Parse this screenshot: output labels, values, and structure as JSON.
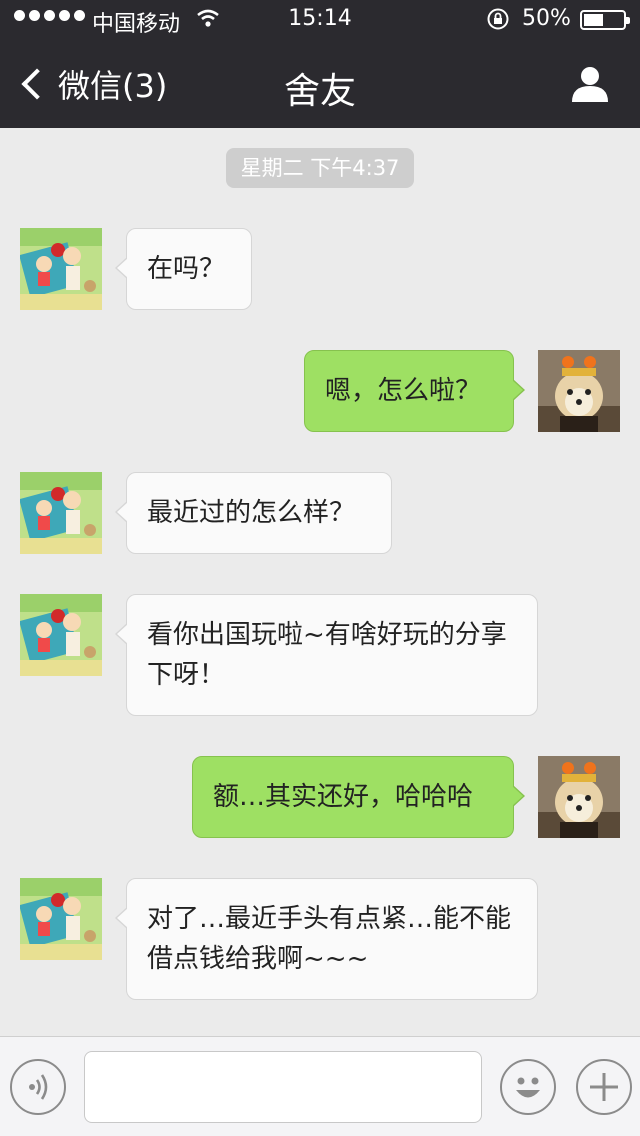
{
  "status_bar": {
    "carrier": "中国移动",
    "time": "15:14",
    "battery": "50%",
    "battery_level": 0.5
  },
  "nav": {
    "back_label": "微信(3)",
    "title": "舍友"
  },
  "chat": {
    "timestamp": "星期二 下午4:37",
    "messages": [
      {
        "direction": "incoming",
        "text": "在吗？"
      },
      {
        "direction": "outgoing",
        "text": "嗯，怎么啦？"
      },
      {
        "direction": "incoming",
        "text": "最近过的怎么样？"
      },
      {
        "direction": "incoming",
        "text": "看你出国玩啦~有啥好玩的分享下呀！"
      },
      {
        "direction": "outgoing",
        "text": "额…其实还好，哈哈哈"
      },
      {
        "direction": "incoming",
        "text": "对了…最近手头有点紧…能不能借点钱给我啊~~~"
      }
    ]
  },
  "input_bar": {
    "voice_icon": "voice-icon",
    "emoji_icon": "emoji-icon",
    "plus_icon": "plus-icon",
    "message_value": ""
  },
  "colors": {
    "header_bg": "#2b2a2f",
    "chat_bg": "#ebebeb",
    "outgoing_bubble": "#9ee063",
    "incoming_bubble": "#fafafa"
  }
}
